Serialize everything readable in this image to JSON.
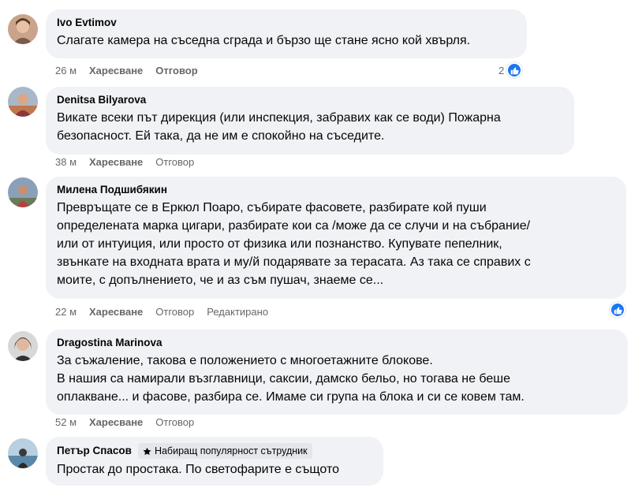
{
  "comments": [
    {
      "author": "Ivo Evtimov",
      "text": "Слагате камера на съседна сграда и бързо ще стане ясно кой хвърля.",
      "time": "26 м",
      "like_label": "Харесване",
      "reply_label": "Отговор",
      "reaction_count": "2"
    },
    {
      "author": "Denitsa Bilyarova",
      "text": "Викате всеки път дирекция (или инспекция, забравих как се води) Пожарна\nбезопасност. Ей така, да не им е спокойно на съседите.",
      "time": "38 м",
      "like_label": "Харесване",
      "reply_label": "Отговор"
    },
    {
      "author": "Милена Подшибякин",
      "text": "Превръщате се в Еркюл Поаро, събирате фасовете, разбирате кой пуши\nопределената марка цигари, разбирате кои са /може да се случи и на събрание/\nили от интуиция, или просто от физика или познанство. Купувате пепелник,\nзвънкате на входната врата и му/й подарявате за терасата. Аз така се справих с\nмоите, с допълнението, че и аз съм пушач, знаеме се...",
      "time": "22 м",
      "like_label": "Харесване",
      "reply_label": "Отговор",
      "edited_label": "Редактирано"
    },
    {
      "author": "Dragostina Marinova",
      "text": "За съжаление, такова е положението с многоетажните блокове.\nВ нашия са намирали възглавници, саксии, дамско бельо, но тогава не беше\nоплакване... и фасове, разбира се. Имаме си група на блока и си се ковем там.",
      "time": "52 м",
      "like_label": "Харесване",
      "reply_label": "Отговор"
    },
    {
      "author": "Петър Спасов",
      "badge": "Набиращ популярност сътрудник",
      "text": "Простак до простака. По светофарите е същото"
    }
  ],
  "colors": {
    "bubble": "#f0f2f5",
    "meta": "#65676b",
    "like_blue": "#1877f2"
  },
  "icons": [
    "like-icon",
    "star-icon"
  ]
}
